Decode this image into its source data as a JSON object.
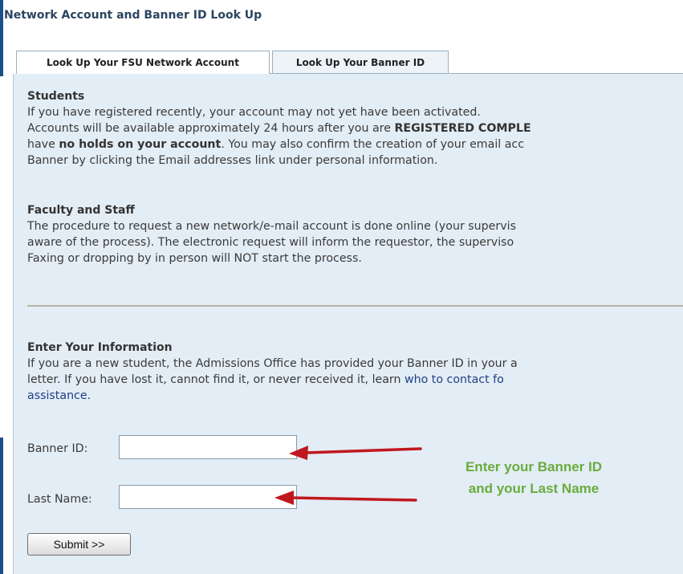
{
  "page": {
    "title": "Network Account and Banner ID Look Up"
  },
  "tabs": [
    {
      "label": "Look Up Your FSU Network Account",
      "active": true
    },
    {
      "label": "Look Up Your Banner ID",
      "active": false
    }
  ],
  "students": {
    "heading": "Students",
    "line1": "If you have registered recently, your account may not yet have been activated.",
    "line2_pre": "Accounts will be available approximately 24 hours after you are ",
    "line2_bold": "REGISTERED COMPLE",
    "line3_pre": "have ",
    "line3_bold": "no holds on your account",
    "line3_post": ". You may also confirm the creation of your email acc",
    "line4": "Banner by clicking the Email addresses link under personal information."
  },
  "faculty": {
    "heading": "Faculty and Staff",
    "line1": "The procedure to request a new network/e-mail account is done online (your supervis",
    "line2": "aware of the process). The electronic request will inform the requestor, the superviso",
    "line3": "Faxing or dropping by in person will NOT start the process."
  },
  "enter_info": {
    "heading": "Enter Your Information",
    "line1": "If you are a new student, the Admissions Office has provided your Banner ID in your a",
    "line2_pre": "letter. If you have lost it, cannot find it, or never received it, learn ",
    "line2_link": "who to contact fo",
    "line3_link": "assistance",
    "line3_post": "."
  },
  "form": {
    "banner_label": "Banner ID:",
    "banner_value": "",
    "lastname_label": "Last Name:",
    "lastname_value": "",
    "submit_label": "Submit >>"
  },
  "annotation": {
    "line1": "Enter your Banner ID",
    "line2": "and your Last Name",
    "color": "#6aac3d",
    "arrow_color": "#c0181e"
  },
  "colors": {
    "panel_bg": "#e3edf5",
    "title": "#2b4560",
    "accent_bar": "#1a4e8c",
    "link": "#1f3f87"
  }
}
